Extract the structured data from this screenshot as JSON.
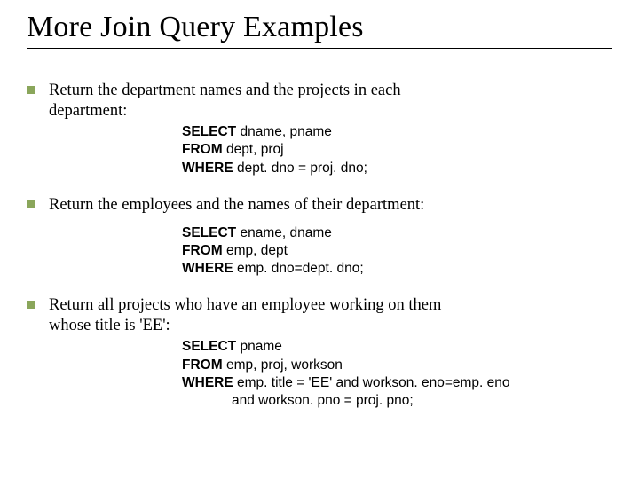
{
  "title": "More Join Query Examples",
  "items": [
    {
      "intro_a": "Return the department names and the  projects in each",
      "intro_b": "department:",
      "sql": {
        "select_kw": "SELECT",
        "select_rest": " dname, pname",
        "from_kw": "FROM",
        "from_rest": " dept, proj",
        "where_kw": "WHERE",
        "where_rest": " dept. dno = proj. dno;",
        "extra": ""
      }
    },
    {
      "intro_a": "Return the employees and the names of their department:",
      "intro_b": "",
      "sql": {
        "select_kw": "SELECT",
        "select_rest": " ename, dname",
        "from_kw": "FROM",
        "from_rest": " emp, dept",
        "where_kw": "WHERE",
        "where_rest": " emp. dno=dept. dno;",
        "extra": ""
      }
    },
    {
      "intro_a": "Return all projects who have an employee working on them",
      "intro_b": "whose title is 'EE':",
      "sql": {
        "select_kw": "SELECT",
        "select_rest": " pname",
        "from_kw": "FROM",
        "from_rest": " emp, proj, workson",
        "where_kw": "WHERE",
        "where_rest": " emp. title = 'EE' and workson. eno=emp. eno",
        "extra": "             and workson. pno = proj. pno;"
      }
    }
  ]
}
